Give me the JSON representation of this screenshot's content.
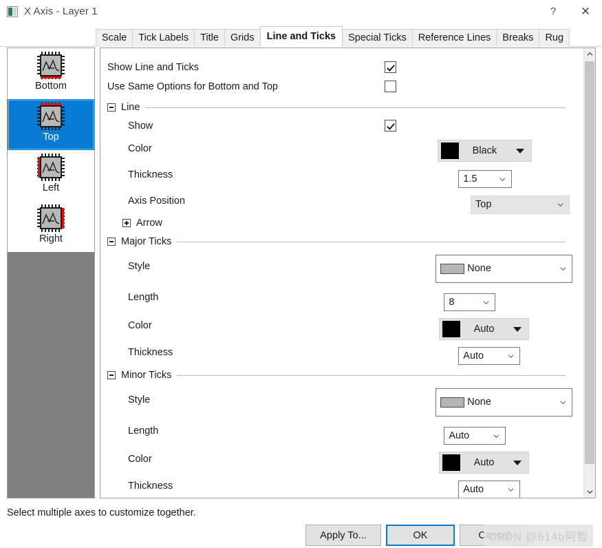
{
  "window": {
    "title": "X Axis - Layer 1",
    "icon": "axis-dialog-icon",
    "help_label": "?",
    "close_label": "✕"
  },
  "tabs": [
    {
      "label": "Scale",
      "active": false
    },
    {
      "label": "Tick Labels",
      "active": false
    },
    {
      "label": "Title",
      "active": false
    },
    {
      "label": "Grids",
      "active": false
    },
    {
      "label": "Line and Ticks",
      "active": true
    },
    {
      "label": "Special Ticks",
      "active": false
    },
    {
      "label": "Reference Lines",
      "active": false
    },
    {
      "label": "Breaks",
      "active": false
    },
    {
      "label": "Rug",
      "active": false
    }
  ],
  "axis_list": {
    "items": [
      {
        "label": "Bottom",
        "highlight": "b",
        "selected": false
      },
      {
        "label": "Top",
        "highlight": "t",
        "selected": true
      },
      {
        "label": "Left",
        "highlight": "l",
        "selected": false
      },
      {
        "label": "Right",
        "highlight": "r",
        "selected": false
      }
    ]
  },
  "settings": {
    "show_line_and_ticks": {
      "label": "Show Line and Ticks",
      "checked": true
    },
    "use_same_options": {
      "label": "Use Same Options for Bottom and Top",
      "checked": false
    },
    "line_group": {
      "title": "Line",
      "expanded": true,
      "show": {
        "label": "Show",
        "checked": true
      },
      "color": {
        "label": "Color",
        "value": "Black",
        "swatch": "#000000"
      },
      "thickness": {
        "label": "Thickness",
        "value": "1.5"
      },
      "axis_position": {
        "label": "Axis Position",
        "value": "Top"
      },
      "arrow": {
        "label": "Arrow",
        "expanded": false
      }
    },
    "major_ticks": {
      "title": "Major Ticks",
      "expanded": true,
      "style": {
        "label": "Style",
        "value": "None"
      },
      "length": {
        "label": "Length",
        "value": "8"
      },
      "color": {
        "label": "Color",
        "value": "Auto",
        "swatch": "#000000"
      },
      "thickness": {
        "label": "Thickness",
        "value": "Auto"
      }
    },
    "minor_ticks": {
      "title": "Minor Ticks",
      "expanded": true,
      "style": {
        "label": "Style",
        "value": "None"
      },
      "length": {
        "label": "Length",
        "value": "Auto"
      },
      "color": {
        "label": "Color",
        "value": "Auto",
        "swatch": "#000000"
      },
      "thickness": {
        "label": "Thickness",
        "value": "Auto"
      }
    }
  },
  "status": {
    "message": "Select multiple axes to customize together."
  },
  "footer": {
    "apply_to": "Apply To...",
    "ok": "OK",
    "cancel": "Cancel"
  },
  "watermark": {
    "text": "CSDN @614b阿智"
  },
  "colors": {
    "selection_blue": "#0a7bd4",
    "panel_gray": "#808080",
    "control_gray": "#e2e2e2"
  }
}
